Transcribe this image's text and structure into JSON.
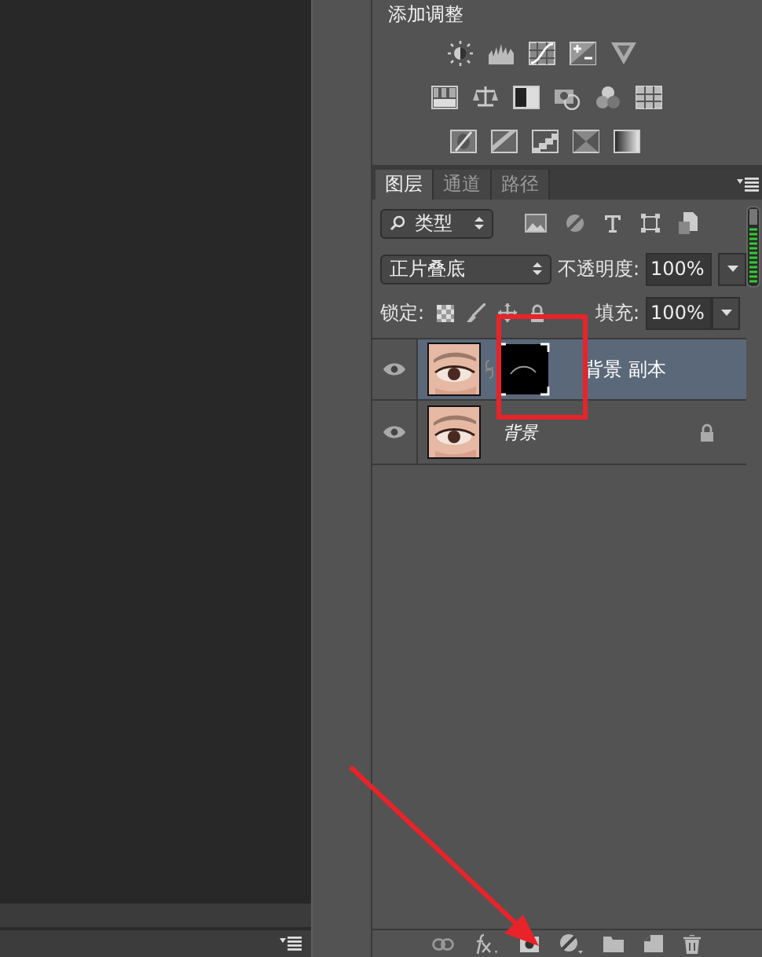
{
  "adjustments": {
    "title": "添加调整"
  },
  "tabs": [
    {
      "label": "图层",
      "selected": true
    },
    {
      "label": "通道",
      "selected": false
    },
    {
      "label": "路径",
      "selected": false
    }
  ],
  "filter": {
    "value": "类型"
  },
  "blend": {
    "value": "正片叠底",
    "opacity_label": "不透明度:",
    "opacity": "100%"
  },
  "lock": {
    "label": "锁定:",
    "fill_label": "填充:",
    "fill": "100%"
  },
  "layers": [
    {
      "name": "背景 副本",
      "selected": true,
      "visible": true,
      "mask": true,
      "italic": false,
      "locked": false
    },
    {
      "name": "背景",
      "selected": false,
      "visible": true,
      "mask": false,
      "italic": true,
      "locked": true
    }
  ]
}
